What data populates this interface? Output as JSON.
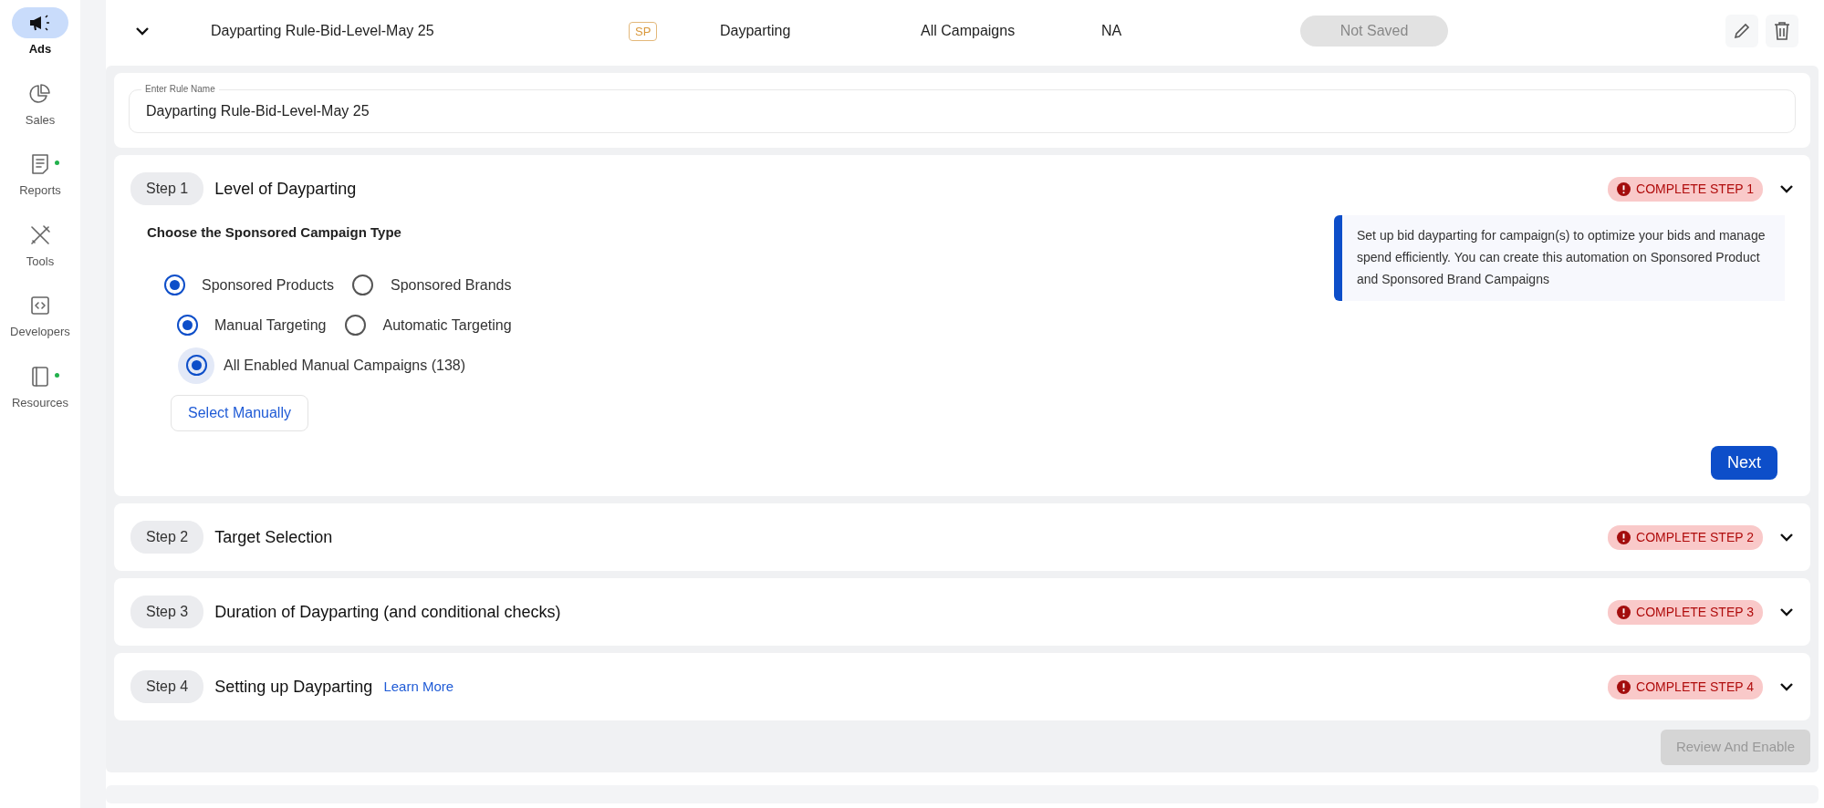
{
  "sidebar": {
    "items": [
      {
        "kind": "ads",
        "label": "Ads",
        "selected": true,
        "dot": false
      },
      {
        "kind": "sales",
        "label": "Sales",
        "selected": false,
        "dot": false
      },
      {
        "kind": "reports",
        "label": "Reports",
        "selected": false,
        "dot": true
      },
      {
        "kind": "tools",
        "label": "Tools",
        "selected": false,
        "dot": false
      },
      {
        "kind": "developers",
        "label": "Developers",
        "selected": false,
        "dot": false
      },
      {
        "kind": "resources",
        "label": "Resources",
        "selected": false,
        "dot": true
      }
    ]
  },
  "rule_row": {
    "expanded": true,
    "column_1": "Dayparting Rule-Bid-Level-May 25",
    "badge": "SP",
    "column_3": "Dayparting",
    "column_4": "All Campaigns",
    "column_5": "NA",
    "status": "Not Saved"
  },
  "rule_name_field": {
    "label": "Enter Rule Name",
    "value": "Dayparting Rule-Bid-Level-May 25"
  },
  "steps": [
    {
      "number": "Step 1",
      "title": "Level of Dayparting",
      "status": "COMPLETE STEP 1"
    },
    {
      "number": "Step 2",
      "title": "Target Selection",
      "status": "COMPLETE STEP 2"
    },
    {
      "number": "Step 3",
      "title": "Duration of Dayparting (and conditional checks)",
      "status": "COMPLETE STEP 3"
    },
    {
      "number": "Step 4",
      "title": "Setting up Dayparting",
      "link": "Learn More",
      "status": "COMPLETE STEP 4"
    }
  ],
  "step_1_body": {
    "heading": "Choose the Sponsored Campaign Type",
    "radio_rows": [
      [
        {
          "label": "Sponsored Products",
          "selected": true,
          "focused": false
        },
        {
          "label": "Sponsored Brands",
          "selected": false,
          "focused": false
        }
      ],
      [
        {
          "label": "Manual Targeting",
          "selected": true,
          "focused": false
        },
        {
          "label": "Automatic Targeting",
          "selected": false,
          "focused": false
        }
      ],
      [
        {
          "label": "All Enabled Manual Campaigns (138)",
          "selected": true,
          "focused": true
        }
      ]
    ],
    "select_button": "Select Manually",
    "info": "Set up bid dayparting for campaign(s) to optimize your bids and manage spend efficiently. You can create this automation on Sponsored Product and Sponsored Brand Campaigns",
    "next_button": "Next"
  },
  "footer": {
    "button": "Review And Enable",
    "disabled": true
  }
}
